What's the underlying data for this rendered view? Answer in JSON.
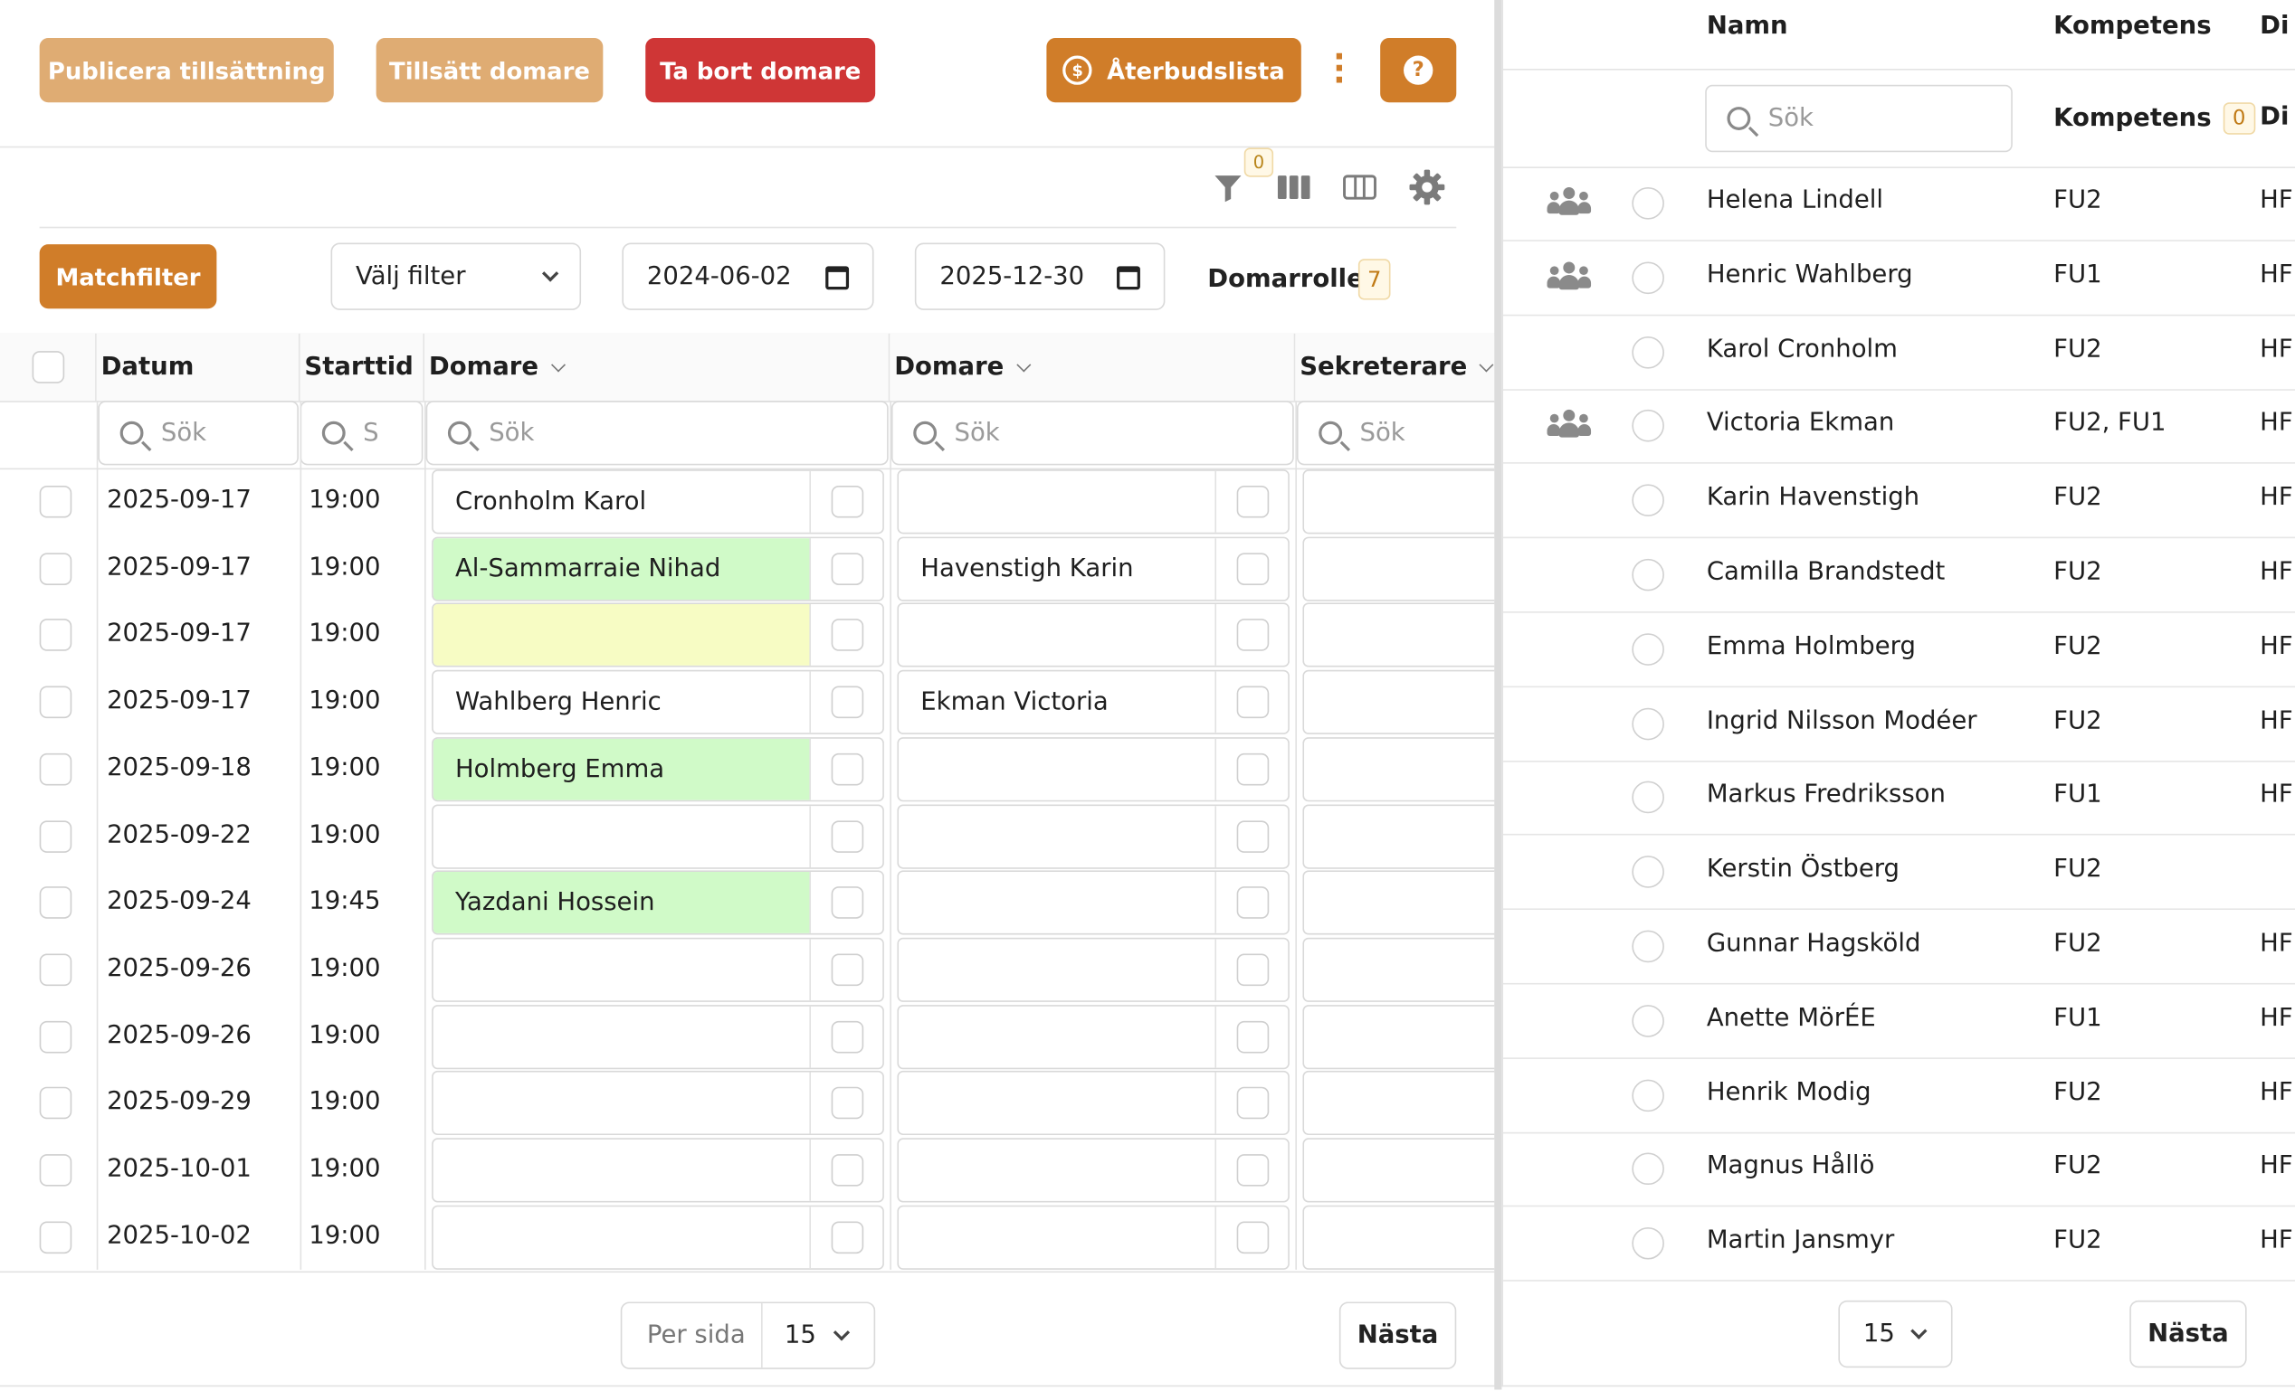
{
  "toolbar": {
    "publish_label": "Publicera tillsättning",
    "assign_label": "Tillsätt domare",
    "remove_label": "Ta bort domare",
    "cancel_list_label": "Återbudslista",
    "help_label": "?"
  },
  "filters": {
    "filter_count": "0",
    "match_filter_label": "Matchfilter",
    "select_filter_label": "Välj filter",
    "date_from": "2024-06-02",
    "date_to": "2025-12-30",
    "referee_roles_label": "Domarroller",
    "referee_roles_count": "7"
  },
  "grid": {
    "columns": {
      "date": "Datum",
      "start": "Starttid",
      "referee1": "Domare",
      "referee2": "Domare",
      "secretary": "Sekreterare"
    },
    "search_placeholder": "Sök",
    "search_placeholder_short": "S",
    "rows": [
      {
        "date": "2025-09-17",
        "time": "19:00",
        "ref1": "Cronholm Karol",
        "ref1_state": "plain",
        "ref2": ""
      },
      {
        "date": "2025-09-17",
        "time": "19:00",
        "ref1": "Al-Sammarraie Nihad",
        "ref1_state": "green",
        "ref2": "Havenstigh Karin"
      },
      {
        "date": "2025-09-17",
        "time": "19:00",
        "ref1": "",
        "ref1_state": "yellow",
        "ref2": ""
      },
      {
        "date": "2025-09-17",
        "time": "19:00",
        "ref1": "Wahlberg Henric",
        "ref1_state": "plain",
        "ref2": "Ekman Victoria"
      },
      {
        "date": "2025-09-18",
        "time": "19:00",
        "ref1": "Holmberg Emma",
        "ref1_state": "green",
        "ref2": ""
      },
      {
        "date": "2025-09-22",
        "time": "19:00",
        "ref1": "",
        "ref1_state": "plain",
        "ref2": ""
      },
      {
        "date": "2025-09-24",
        "time": "19:45",
        "ref1": "Yazdani Hossein",
        "ref1_state": "green",
        "ref2": ""
      },
      {
        "date": "2025-09-26",
        "time": "19:00",
        "ref1": "",
        "ref1_state": "plain",
        "ref2": ""
      },
      {
        "date": "2025-09-26",
        "time": "19:00",
        "ref1": "",
        "ref1_state": "plain",
        "ref2": ""
      },
      {
        "date": "2025-09-29",
        "time": "19:00",
        "ref1": "",
        "ref1_state": "plain",
        "ref2": ""
      },
      {
        "date": "2025-10-01",
        "time": "19:00",
        "ref1": "",
        "ref1_state": "plain",
        "ref2": ""
      },
      {
        "date": "2025-10-02",
        "time": "19:00",
        "ref1": "",
        "ref1_state": "plain",
        "ref2": ""
      }
    ]
  },
  "pager": {
    "per_page_label": "Per sida",
    "per_page_value": "15",
    "next_label": "Nästa"
  },
  "referee_list": {
    "columns": {
      "name": "Namn",
      "competence": "Kompetens",
      "district": "Di"
    },
    "search_placeholder": "Sök",
    "competence_filter_label": "Kompetens",
    "competence_filter_count": "0",
    "district_filter_label": "Di",
    "rows": [
      {
        "group": true,
        "name": "Helena Lindell",
        "competence": "FU2",
        "district": "HF"
      },
      {
        "group": true,
        "name": "Henric Wahlberg",
        "competence": "FU1",
        "district": "HF"
      },
      {
        "group": false,
        "name": "Karol Cronholm",
        "competence": "FU2",
        "district": "HF"
      },
      {
        "group": true,
        "name": "Victoria Ekman",
        "competence": "FU2, FU1",
        "district": "HF"
      },
      {
        "group": false,
        "name": "Karin Havenstigh",
        "competence": "FU2",
        "district": "HF"
      },
      {
        "group": false,
        "name": "Camilla Brandstedt",
        "competence": "FU2",
        "district": "HF"
      },
      {
        "group": false,
        "name": "Emma Holmberg",
        "competence": "FU2",
        "district": "HF"
      },
      {
        "group": false,
        "name": "Ingrid Nilsson Modéer",
        "competence": "FU2",
        "district": "HF"
      },
      {
        "group": false,
        "name": "Markus Fredriksson",
        "competence": "FU1",
        "district": "HF"
      },
      {
        "group": false,
        "name": "Kerstin Östberg",
        "competence": "FU2",
        "district": ""
      },
      {
        "group": false,
        "name": "Gunnar Hagsköld",
        "competence": "FU2",
        "district": "HF"
      },
      {
        "group": false,
        "name": "Anette MörÉE",
        "competence": "FU1",
        "district": "HF"
      },
      {
        "group": false,
        "name": "Henrik Modig",
        "competence": "FU2",
        "district": "HF"
      },
      {
        "group": false,
        "name": "Magnus Hållö",
        "competence": "FU2",
        "district": "HF"
      },
      {
        "group": false,
        "name": "Martin Jansmyr",
        "competence": "FU2",
        "district": "HF"
      }
    ],
    "per_page_value": "15",
    "next_label": "Nästa"
  },
  "colors": {
    "accent": "#d07d29",
    "accent_light": "#dfac73",
    "danger": "#cf3636",
    "assigned_green": "#d0fac8",
    "pending_yellow": "#f7fcc4"
  }
}
